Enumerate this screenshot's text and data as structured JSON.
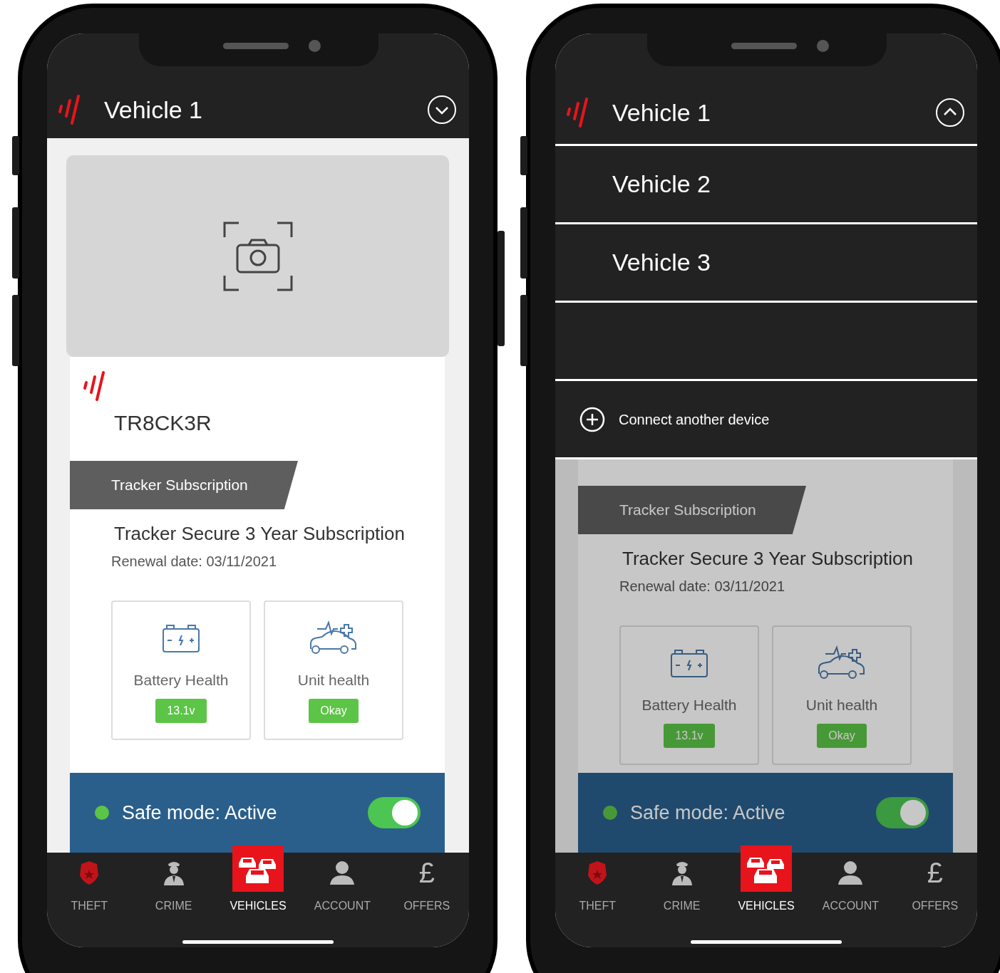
{
  "phones": [
    {
      "header": {
        "title": "Vehicle 1",
        "expanded": false
      },
      "device": {
        "name": "TR8CK3R"
      },
      "subscription": {
        "banner": "Tracker Subscription",
        "plan": "Tracker Secure 3 Year Subscription",
        "renewal": "Renewal date: 03/11/2021"
      },
      "tiles": [
        {
          "kind": "battery",
          "label": "Battery Health",
          "value": "13.1v"
        },
        {
          "kind": "unit",
          "label": "Unit health",
          "value": "Okay"
        }
      ],
      "safe_mode": {
        "label": "Safe mode: Active",
        "on": true
      },
      "nav": [
        {
          "kind": "theft",
          "label": "THEFT",
          "selected": false
        },
        {
          "kind": "crime",
          "label": "CRIME",
          "selected": false
        },
        {
          "kind": "vehicles",
          "label": "VEHICLES",
          "selected": true
        },
        {
          "kind": "account",
          "label": "ACCOUNT",
          "selected": false
        },
        {
          "kind": "offers",
          "label": "OFFERS",
          "icon": "£",
          "selected": false
        }
      ]
    },
    {
      "header": {
        "title": "Vehicle 1",
        "expanded": true
      },
      "menu": {
        "items": [
          {
            "label": "Vehicle 2"
          },
          {
            "label": "Vehicle 3"
          }
        ],
        "action": "Connect another device"
      },
      "dimmed": true,
      "subscription": {
        "banner": "Tracker Subscription",
        "plan": "Tracker Secure 3 Year Subscription",
        "renewal": "Renewal date: 03/11/2021"
      },
      "tiles": [
        {
          "kind": "battery",
          "label": "Battery Health",
          "value": "13.1v"
        },
        {
          "kind": "unit",
          "label": "Unit health",
          "value": "Okay"
        }
      ],
      "safe_mode": {
        "label": "Safe mode: Active",
        "on": true
      },
      "nav": [
        {
          "kind": "theft",
          "label": "THEFT",
          "selected": false
        },
        {
          "kind": "crime",
          "label": "CRIME",
          "selected": false
        },
        {
          "kind": "vehicles",
          "label": "VEHICLES",
          "selected": true
        },
        {
          "kind": "account",
          "label": "ACCOUNT",
          "selected": false
        },
        {
          "kind": "offers",
          "label": "OFFERS",
          "icon": "£",
          "selected": false
        }
      ]
    }
  ]
}
